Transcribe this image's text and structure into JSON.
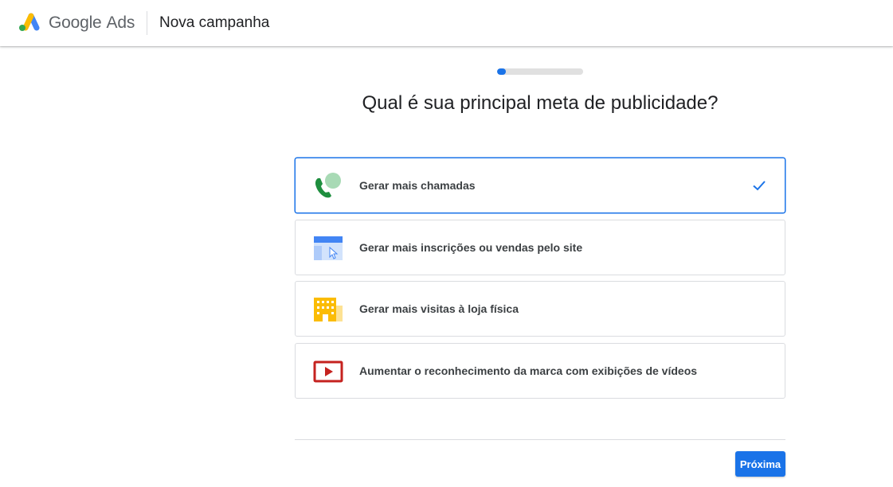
{
  "header": {
    "brand_google": "Google",
    "brand_ads": "Ads",
    "page_title": "Nova campanha"
  },
  "progress": {
    "fraction": 0.1
  },
  "question": "Qual é sua principal meta de publicidade?",
  "options": [
    {
      "label": "Gerar mais chamadas",
      "icon": "phone-call-icon",
      "selected": true
    },
    {
      "label": "Gerar mais inscrições ou vendas pelo site",
      "icon": "website-click-icon",
      "selected": false
    },
    {
      "label": "Gerar mais visitas à loja física",
      "icon": "store-building-icon",
      "selected": false
    },
    {
      "label": "Aumentar o reconhecimento da marca com exibições de vídeos",
      "icon": "video-play-icon",
      "selected": false
    }
  ],
  "footer": {
    "next_label": "Próxima"
  },
  "colors": {
    "accent": "#1a73e8",
    "border": "#dadce0"
  }
}
